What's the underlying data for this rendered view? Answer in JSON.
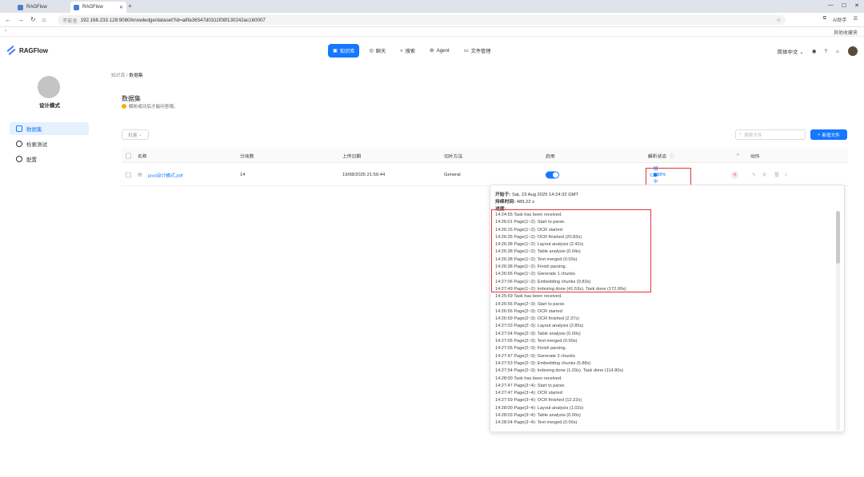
{
  "browser": {
    "tabs": [
      {
        "title": "RAGFlow"
      },
      {
        "title": "RAGFlow"
      }
    ],
    "url_warning": "不安全",
    "url": "192.168.233.128:9080/knowledge/dataset?id=a8fa36547d0311f08f130242ac160007",
    "ai_label": "AI助手",
    "fav_right": "其他收藏夹"
  },
  "header": {
    "brand": "RAGFlow",
    "nav": [
      {
        "label": "知识库",
        "active": true
      },
      {
        "label": "聊天"
      },
      {
        "label": "搜索"
      },
      {
        "label": "Agent"
      },
      {
        "label": "文件管理"
      }
    ],
    "language": "简体中文"
  },
  "sidebar": {
    "user_name": "设计模式",
    "items": [
      {
        "label": "数据集",
        "active": true
      },
      {
        "label": "检索测试"
      },
      {
        "label": "配置"
      }
    ]
  },
  "breadcrumb": {
    "parent": "知识库",
    "current": "数据集"
  },
  "page": {
    "title": "数据集",
    "subtitle": "解析成功后才能问答哦。"
  },
  "toolbar": {
    "bulk": "批量",
    "search_placeholder": "搜索文件",
    "add": "新增文件"
  },
  "table": {
    "headers": {
      "name": "名称",
      "chunks": "分块数",
      "upload": "上传日期",
      "method": "切片方法",
      "enable": "启用",
      "status": "解析状态",
      "action": "动作"
    },
    "rows": [
      {
        "name": "java设计模式.pdf",
        "chunks": "14",
        "upload": "19/08/2025 21:56:44",
        "method": "General",
        "status": "解析中",
        "progress": "2.88%"
      }
    ]
  },
  "popover": {
    "start_label": "开始于:",
    "start_value": "Sat, 23 Aug 2025 14:24:32 GMT",
    "duration_label": "持续时间:",
    "duration_value": "489.22 s",
    "progress_label": "进度:",
    "log": [
      "14:24:55 Task has been received.",
      "14:26:01 Page(1~2): Start to parse.",
      "14:26:15 Page(1~2): OCR started",
      "14:26:35 Page(1~2): OCR finished (20.83s)",
      "14:26:38 Page(1~2): Layout analysis (2.42s)",
      "14:26:38 Page(1~2): Table analysis (0.04s)",
      "14:26:38 Page(1~2): Text merged (0.03s)",
      "14:26:38 Page(1~2): Finish parsing.",
      "14:26:56 Page(1~2): Generate 1 chunks",
      "14:27:06 Page(1~2): Embedding chunks (9.83s)",
      "14:27:49 Page(1~2): Indexing done (41.53s). Task done (172.00s)",
      "14:25:59 Task has been received.",
      "14:26:56 Page(2~3): Start to parse.",
      "14:26:56 Page(2~3): OCR started",
      "14:26:59 Page(2~3): OCR finished (2.37s)",
      "14:27:03 Page(2~3): Layout analysis (2.85s)",
      "14:27:04 Page(2~3): Table analysis (0.00s)",
      "14:27:05 Page(2~3): Text merged (0.00s)",
      "14:27:05 Page(2~3): Finish parsing.",
      "14:27:47 Page(2~3): Generate 2 chunks",
      "14:27:53 Page(2~3): Embedding chunks (5.88s)",
      "14:27:54 Page(2~3): Indexing done (1.03s). Task done (114.80s)",
      "14:28:00 Task has been received.",
      "14:27:47 Page(3~4): Start to parse.",
      "14:27:47 Page(3~4): OCR started",
      "14:27:59 Page(3~4): OCR finished (12.22s)",
      "14:28:00 Page(3~4): Layout analysis (1.02s)",
      "14:28:03 Page(3~4): Table analysis (0.00s)",
      "14:28:04 Page(3~4): Text merged (0.00s)"
    ]
  },
  "colors": {
    "accent": "#1677ff",
    "highlight": "#e0353d"
  }
}
